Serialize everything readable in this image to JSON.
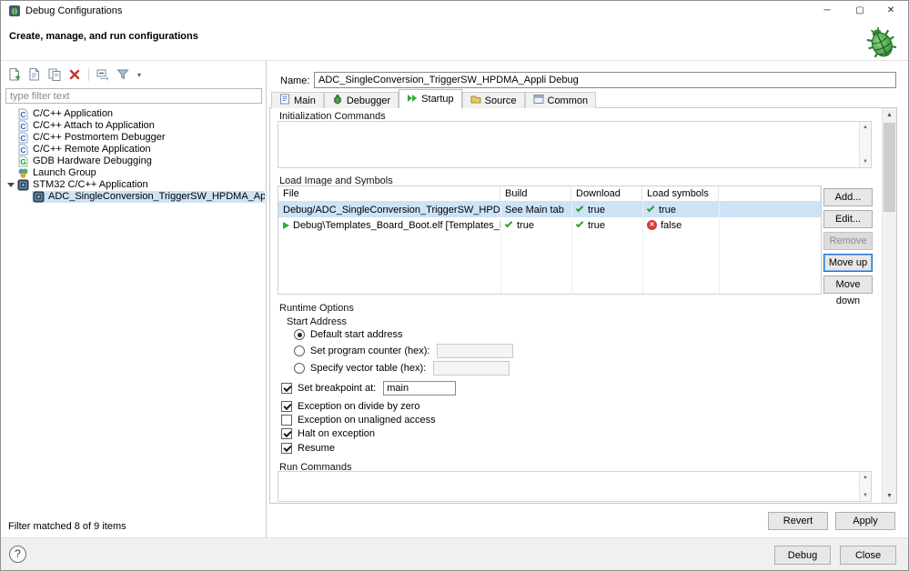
{
  "window": {
    "title": "Debug Configurations",
    "controls": {
      "minimize": "─",
      "maximize": "▢",
      "close": "✕"
    }
  },
  "header": {
    "title": "Create, manage, and run configurations"
  },
  "left_panel": {
    "filter_placeholder": "type filter text",
    "tree": [
      {
        "label": "C/C++ Application"
      },
      {
        "label": "C/C++ Attach to Application"
      },
      {
        "label": "C/C++ Postmortem Debugger"
      },
      {
        "label": "C/C++ Remote Application"
      },
      {
        "label": "GDB Hardware Debugging"
      },
      {
        "label": "Launch Group"
      },
      {
        "label": "STM32 C/C++ Application",
        "expanded": true
      },
      {
        "label": "ADC_SingleConversion_TriggerSW_HPDMA_Appli Debug",
        "selected": true
      }
    ],
    "status": "Filter matched 8 of 9 items"
  },
  "config": {
    "name_label": "Name:",
    "name_value": "ADC_SingleConversion_TriggerSW_HPDMA_Appli Debug",
    "tabs": [
      {
        "label": "Main"
      },
      {
        "label": "Debugger"
      },
      {
        "label": "Startup",
        "active": true
      },
      {
        "label": "Source"
      },
      {
        "label": "Common"
      }
    ],
    "startup": {
      "init_commands_label": "Initialization Commands",
      "load_section": {
        "title": "Load Image and Symbols",
        "columns": [
          "File",
          "Build",
          "Download",
          "Load symbols"
        ],
        "rows": [
          {
            "file": "Debug/ADC_SingleConversion_TriggerSW_HPDMA_Appli.el...",
            "build": "See Main tab",
            "download": "true",
            "load_symbols": "true",
            "download_ok": true,
            "symbols_ok": true,
            "selected": true
          },
          {
            "file": "Debug\\Templates_Board_Boot.elf [Templates_Board_Boot]",
            "build": "true",
            "download": "true",
            "load_symbols": "false",
            "build_ok": true,
            "download_ok": true,
            "symbols_ok": false
          }
        ],
        "buttons": {
          "add": "Add...",
          "edit": "Edit...",
          "remove": "Remove",
          "move_up": "Move up",
          "move_down": "Move down"
        }
      },
      "runtime": {
        "title": "Runtime Options",
        "start_address_label": "Start Address",
        "radios": [
          {
            "label": "Default start address",
            "selected": true
          },
          {
            "label": "Set program counter (hex):",
            "selected": false
          },
          {
            "label": "Specify vector table (hex):",
            "selected": false
          }
        ],
        "checkboxes": [
          {
            "label": "Set breakpoint at:",
            "checked": true,
            "value": "main"
          },
          {
            "label": "Exception on divide by zero",
            "checked": true
          },
          {
            "label": "Exception on unaligned access",
            "checked": false
          },
          {
            "label": "Halt on exception",
            "checked": true
          },
          {
            "label": "Resume",
            "checked": true
          }
        ]
      },
      "run_commands_label": "Run Commands"
    },
    "revert": "Revert",
    "apply": "Apply"
  },
  "footer": {
    "help": "?",
    "debug": "Debug",
    "close": "Close"
  },
  "icons": {
    "cross": "✕",
    "up_arrow": "▲",
    "down_arrow": "▼",
    "dropdown": "▾"
  },
  "colors": {
    "selection": "#cde3f6",
    "check_green": "#23a12c",
    "cross_red": "#d93a3a",
    "focus_blue": "#0078d7"
  }
}
